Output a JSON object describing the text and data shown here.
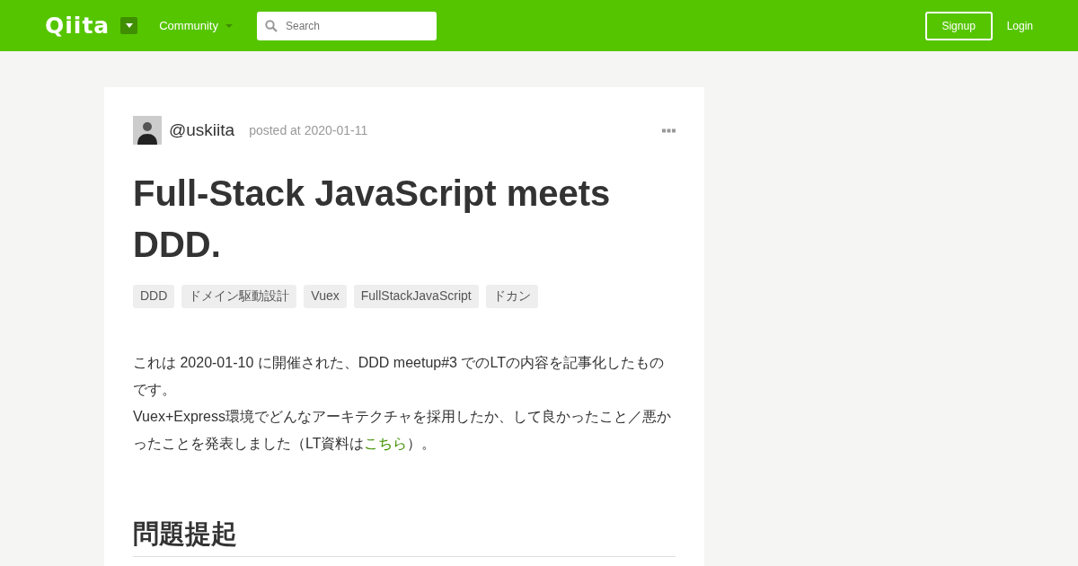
{
  "header": {
    "logo": "Qiita",
    "community_menu": "Community",
    "search": {
      "placeholder": "Search"
    },
    "signup": "Signup",
    "login": "Login"
  },
  "article": {
    "author": "@uskiita",
    "posted": "posted at 2020-01-11",
    "title": "Full-Stack JavaScript meets DDD.",
    "tags": [
      "DDD",
      "ドメイン駆動設計",
      "Vuex",
      "FullStackJavaScript",
      "ドカン"
    ],
    "paragraph": {
      "line_1": "これは 2020-01-10 に開催された、DDD meetup#3 でのLTの内容を記事化したものです。",
      "line_2": "Vuex+Express環境でどんなアーキテクチャを採用したか、して良かったこと／悪かったことを発表しました（LT資料は",
      "link": "こちら",
      "line_2_end": "）。"
    },
    "heading": "問題提起"
  }
}
